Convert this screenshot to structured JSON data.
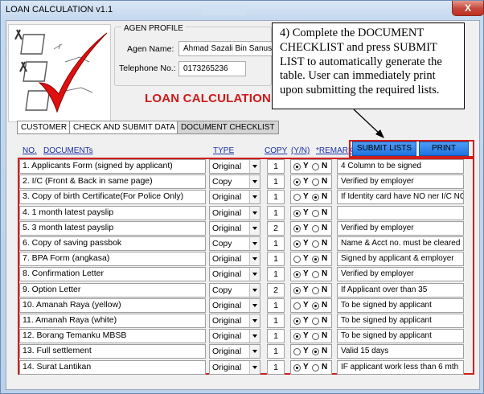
{
  "window": {
    "title": "LOAN CALCULATION v1.1",
    "close_glyph": "X"
  },
  "agent": {
    "section_title": "AGEN PROFILE",
    "name_label": "Agen Name:",
    "name_value": "Ahmad Sazali Bin Sanusi",
    "phone_label": "Telephone No.:",
    "phone_value": "0173265236"
  },
  "heading": "LOAN CALCULATION",
  "callout": "4) Complete the DOCUMENT CHECKLIST and press SUBMIT LIST to automatically generate the table. User can immediately print upon submitting the required lists.",
  "tabs": [
    {
      "label": "CUSTOMER"
    },
    {
      "label": "CHECK AND SUBMIT DATA"
    },
    {
      "label": "DOCUMENT CHECKLIST"
    }
  ],
  "buttons": {
    "submit": "SUBMIT LISTS",
    "print": "PRINT"
  },
  "headers": {
    "no": "NO.",
    "documents": "DOCUMENTs",
    "type": "TYPE",
    "copy": "COPY",
    "yn": "(Y/N)",
    "remark": "*REMARK"
  },
  "yn_labels": {
    "y": "Y",
    "n": "N"
  },
  "rows": [
    {
      "doc": "1.  Applicants Form (signed by applicant)",
      "type": "Original",
      "copy": "1",
      "choice": "Y",
      "remark": "4 Column to be signed"
    },
    {
      "doc": "2.  I/C (Front & Back in same page)",
      "type": "Copy",
      "copy": "1",
      "choice": "Y",
      "remark": "Verified by employer"
    },
    {
      "doc": "3.  Copy of birth Certificate(For Police Only)",
      "type": "Original",
      "copy": "1",
      "choice": "N",
      "remark": "If Identity card have NO ner I/C NO"
    },
    {
      "doc": "4.  1 month latest payslip",
      "type": "Original",
      "copy": "1",
      "choice": "Y",
      "remark": ""
    },
    {
      "doc": "5.  3 month latest payslip",
      "type": "Original",
      "copy": "2",
      "choice": "Y",
      "remark": "Verified by employer"
    },
    {
      "doc": "6.  Copy of saving passbok",
      "type": "Copy",
      "copy": "1",
      "choice": "Y",
      "remark": "Name & Acct no. must be cleared"
    },
    {
      "doc": "7.  BPA Form (angkasa)",
      "type": "Original",
      "copy": "1",
      "choice": "N",
      "remark": "Signed by applicant & employer"
    },
    {
      "doc": "8.  Confirmation Letter",
      "type": "Original",
      "copy": "1",
      "choice": "Y",
      "remark": "Verified by employer"
    },
    {
      "doc": "9.  Option Letter",
      "type": "Copy",
      "copy": "2",
      "choice": "Y",
      "remark": "If Applicant over than 35"
    },
    {
      "doc": "10.  Amanah Raya (yellow)",
      "type": "Original",
      "copy": "1",
      "choice": "N",
      "remark": "To be signed by applicant"
    },
    {
      "doc": "11.  Amanah Raya (white)",
      "type": "Original",
      "copy": "1",
      "choice": "Y",
      "remark": "To be signed by applicant"
    },
    {
      "doc": "12.  Borang Temanku MBSB",
      "type": "Original",
      "copy": "1",
      "choice": "Y",
      "remark": "To be signed by applicant"
    },
    {
      "doc": "13.  Full settlement",
      "type": "Original",
      "copy": "1",
      "choice": "N",
      "remark": "Valid 15 days"
    },
    {
      "doc": "14.  Surat Lantikan",
      "type": "Original",
      "copy": "1",
      "choice": "Y",
      "remark": "IF applicant work less than 6 mth"
    }
  ],
  "colors": {
    "accent_red": "#d21d1d",
    "heading_red": "#d01818",
    "header_blue": "#1c2fa8",
    "button_blue": "#1e73e0"
  }
}
